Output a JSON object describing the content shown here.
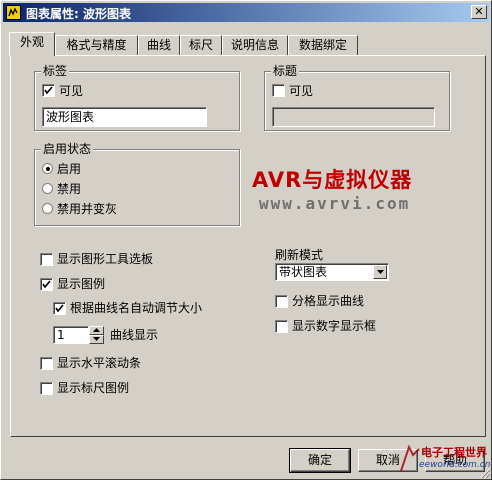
{
  "window": {
    "title": "图表属性: 波形图表",
    "icon": "labview-vi-icon"
  },
  "tabs": [
    {
      "label": "外观",
      "active": true
    },
    {
      "label": "格式与精度",
      "active": false
    },
    {
      "label": "曲线",
      "active": false
    },
    {
      "label": "标尺",
      "active": false
    },
    {
      "label": "说明信息",
      "active": false
    },
    {
      "label": "数据绑定",
      "active": false
    }
  ],
  "label_group": {
    "title": "标签",
    "visible_label": "可见",
    "visible_checked": true,
    "text_value": "波形图表"
  },
  "caption_group": {
    "title": "标题",
    "visible_label": "可见",
    "visible_checked": false,
    "text_value": ""
  },
  "enable_group": {
    "title": "启用状态",
    "options": [
      {
        "label": "启用",
        "selected": true
      },
      {
        "label": "禁用",
        "selected": false
      },
      {
        "label": "禁用并变灰",
        "selected": false
      }
    ]
  },
  "watermark": {
    "title": "AVR与虚拟仪器",
    "url": "www.avrvi.com"
  },
  "options_left": {
    "show_graph_palette": {
      "label": "显示图形工具选板",
      "checked": false
    },
    "show_plot_legend": {
      "label": "显示图例",
      "checked": true
    },
    "autosize_legend": {
      "label": "根据曲线名自动调节大小",
      "checked": true
    },
    "plot_count": {
      "value": "1",
      "label": "曲线显示"
    },
    "show_scrollbar": {
      "label": "显示水平滚动条",
      "checked": false
    },
    "show_scale_legend": {
      "label": "显示标尺图例",
      "checked": false
    }
  },
  "update_mode": {
    "label": "刷新模式",
    "selected": "带状图表"
  },
  "options_right": {
    "stack_plots": {
      "label": "分格显示曲线",
      "checked": false
    },
    "digital_display": {
      "label": "显示数字显示框",
      "checked": false
    }
  },
  "buttons": {
    "ok": "确定",
    "cancel": "取消",
    "help": "帮助"
  },
  "corner_watermark": {
    "cn": "电子工程世界",
    "en": "eeworld.com.cn"
  },
  "colors": {
    "titlebar_start": "#0a246a",
    "titlebar_end": "#a6caf0",
    "face": "#d4d0c8",
    "watermark_red": "#c00000"
  }
}
